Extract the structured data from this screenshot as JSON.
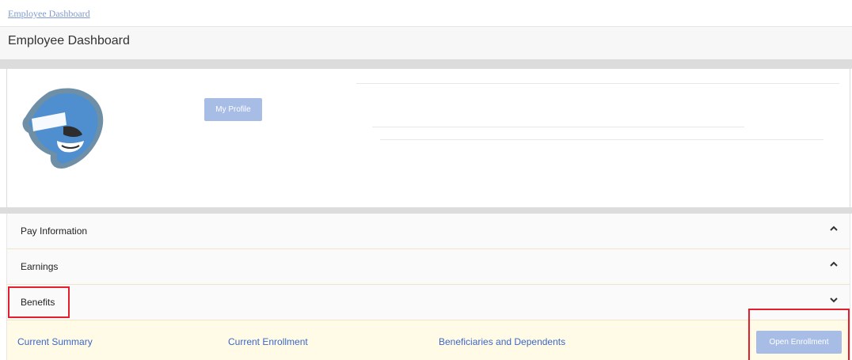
{
  "breadcrumb": "Employee Dashboard",
  "page_title": "Employee Dashboard",
  "profile": {
    "button_label": "My Profile"
  },
  "sections": [
    {
      "label": "Pay Information",
      "chevron": "chevron-up-icon"
    },
    {
      "label": "Earnings",
      "chevron": "chevron-up-icon"
    },
    {
      "label": "Benefits",
      "chevron": "chevron-down-icon"
    }
  ],
  "benefits_links": [
    {
      "label": "Current Summary"
    },
    {
      "label": "Current Enrollment"
    },
    {
      "label": "Beneficiaries and Dependents"
    }
  ],
  "open_enrollment_label": "Open Enrollment",
  "colors": {
    "accent_button": "#a7bde6",
    "link": "#3c67c8",
    "highlight_outline": "#e41f2d",
    "benefits_row_bg": "#fffbe6"
  }
}
